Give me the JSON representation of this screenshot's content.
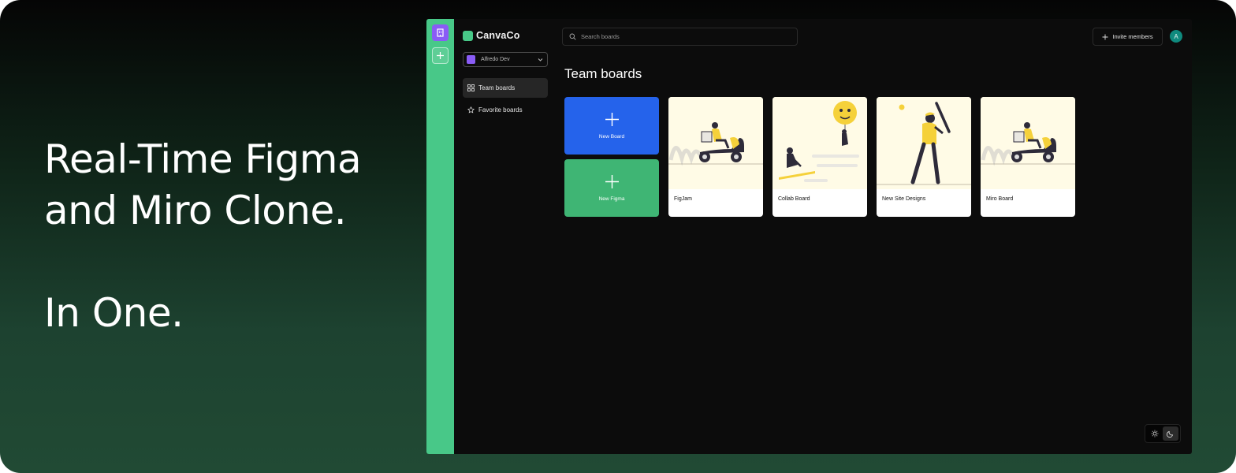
{
  "banner": {
    "line1": "Real-Time Figma",
    "line2": "and Miro Clone.",
    "line3": "In One."
  },
  "app": {
    "brand": "CanvaCo",
    "org_selector": "Alfredo Dev",
    "nav": [
      {
        "label": "Team boards",
        "icon": "dashboard-icon",
        "active": true
      },
      {
        "label": "Favorite boards",
        "icon": "star-icon",
        "active": false
      }
    ],
    "search": {
      "placeholder": "Search boards"
    },
    "invite_label": "Invite members",
    "user_initial": "A",
    "page_title": "Team boards",
    "create_tiles": [
      {
        "label": "New Board",
        "color": "#2563eb"
      },
      {
        "label": "New Figma",
        "color": "#3fb574"
      }
    ],
    "boards": [
      {
        "title": "FigJam",
        "illustration": "scooter-rider"
      },
      {
        "title": "Collab Board",
        "illustration": "balloon-people"
      },
      {
        "title": "New Site Designs",
        "illustration": "baseball-player"
      },
      {
        "title": "Miro Board",
        "illustration": "scooter-rider"
      }
    ],
    "theme_toggle": {
      "options": [
        "sun-icon",
        "moon-icon"
      ],
      "selected": "moon-icon"
    },
    "colors": {
      "rail": "#48c888",
      "org": "#8a5cf6",
      "accent_yellow": "#f5d13a",
      "background": "#0c0c0c"
    }
  }
}
